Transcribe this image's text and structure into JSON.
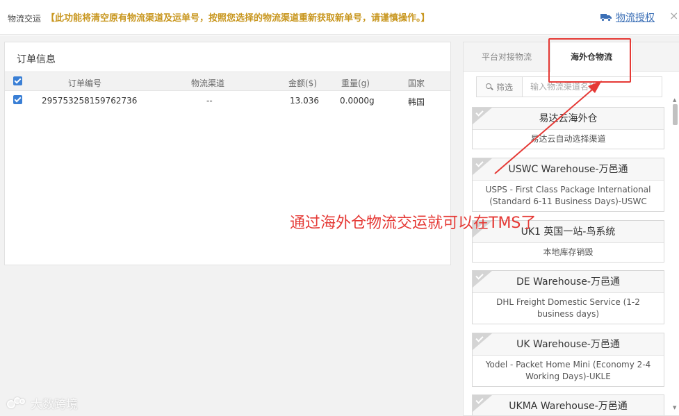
{
  "header": {
    "title": "物流交运",
    "warning": "【此功能将清空原有物流渠道及运单号，按照您选择的物流渠道重新获取新单号，请谨慎操作。】",
    "auth_icon": "truck-icon",
    "auth_label": "物流授权",
    "close_glyph": "×"
  },
  "order_panel": {
    "title": "订单信息",
    "columns": {
      "order_no": "订单编号",
      "channel": "物流渠道",
      "amount": "金额($)",
      "weight": "重量(g)",
      "country": "国家"
    },
    "rows": [
      {
        "order_no": "295753258159762736",
        "channel": "--",
        "amount": "13.036",
        "weight": "0.0000g",
        "country": "韩国"
      }
    ]
  },
  "channel_panel": {
    "tabs": {
      "platform": "平台对接物流",
      "overseas": "海外仓物流"
    },
    "active_tab": "overseas",
    "search": {
      "button": "筛选",
      "placeholder": "输入物流渠道名称"
    },
    "cards": [
      {
        "name": "易达云海外仓",
        "service": "易达云自动选择渠道"
      },
      {
        "name": "USWC Warehouse-万邑通",
        "service": "USPS - First Class Package International (Standard 6-11 Business Days)-USWC"
      },
      {
        "name": "UK1 英国一站-鸟系统",
        "service": "本地库存销毁"
      },
      {
        "name": "DE Warehouse-万邑通",
        "service": "DHL Freight Domestic Service (1-2 business days)"
      },
      {
        "name": "UK Warehouse-万邑通",
        "service": "Yodel - Packet Home Mini (Economy 2-4 Working Days)-UKLE"
      },
      {
        "name": "UKMA Warehouse-万邑通",
        "service": ""
      }
    ]
  },
  "annotation": {
    "text": "通过海外仓物流交运就可以在TMS了",
    "color": "#e53935"
  },
  "watermark": {
    "text": "大数跨境"
  }
}
